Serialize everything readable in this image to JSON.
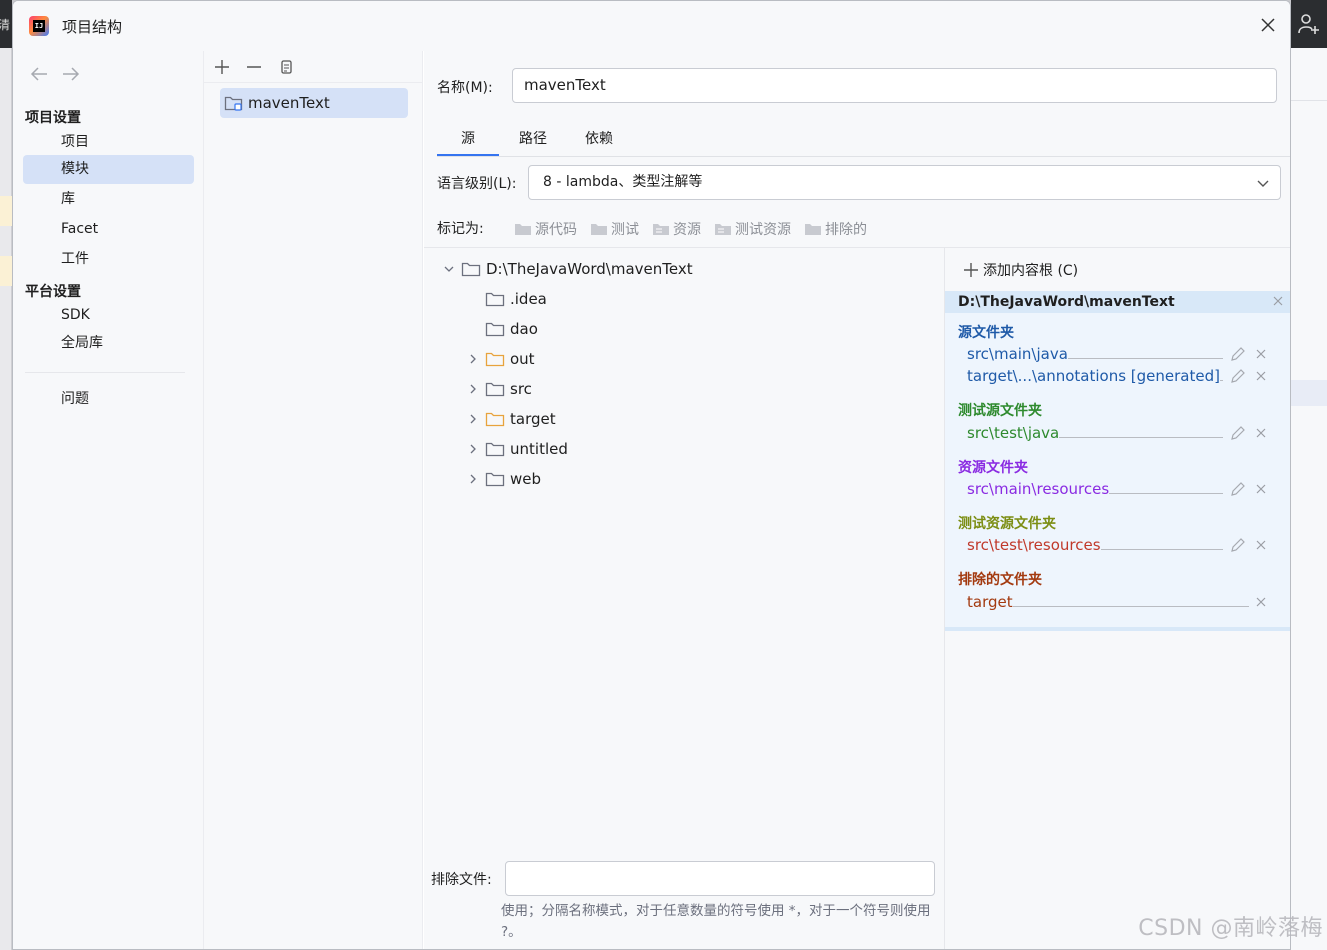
{
  "window": {
    "title": "项目结构"
  },
  "nav": {
    "section_project": "项目设置",
    "items_project": [
      "项目",
      "模块",
      "库",
      "Facet",
      "工件"
    ],
    "section_platform": "平台设置",
    "items_platform": [
      "SDK",
      "全局库"
    ],
    "problems": "问题",
    "selected": "模块"
  },
  "modules": {
    "items": [
      "mavenText"
    ]
  },
  "main": {
    "name_label": "名称(M):",
    "name_value": "mavenText",
    "tabs": [
      "源",
      "路径",
      "依赖"
    ],
    "active_tab": "源",
    "lang_label": "语言级别(L):",
    "lang_value": "8 - lambda、类型注解等",
    "mark_label": "标记为:",
    "mark_buttons": [
      "源代码",
      "测试",
      "资源",
      "测试资源",
      "排除的"
    ],
    "tree": {
      "root": "D:\\TheJavaWord\\mavenText",
      "children": [
        ".idea",
        "dao",
        "out",
        "src",
        "target",
        "untitled",
        "web"
      ]
    },
    "exclude_label": "排除文件:",
    "exclude_value": "",
    "exclude_hint": "使用；分隔名称模式，对于任意数量的符号使用 *，对于一个符号则使用 ?。"
  },
  "content_roots": {
    "add_label": "添加内容根 (C)",
    "root": "D:\\TheJavaWord\\mavenText",
    "groups": [
      {
        "title": "源文件夹",
        "color": "#1f5aa8",
        "items": [
          "src\\main\\java",
          "target\\...\\annotations [generated]"
        ]
      },
      {
        "title": "测试源文件夹",
        "color": "#2e8a2e",
        "items": [
          "src\\test\\java"
        ]
      },
      {
        "title": "资源文件夹",
        "color": "#8a2be2",
        "items": [
          "src\\main\\resources"
        ]
      },
      {
        "title": "测试资源文件夹",
        "color": "#7c8e14",
        "items": [
          "src\\test\\resources"
        ]
      },
      {
        "title": "排除的文件夹",
        "color": "#a33a10",
        "items": [
          "target"
        ]
      }
    ]
  },
  "background": {
    "left_text": "清"
  },
  "watermark": "CSDN @南岭落梅"
}
